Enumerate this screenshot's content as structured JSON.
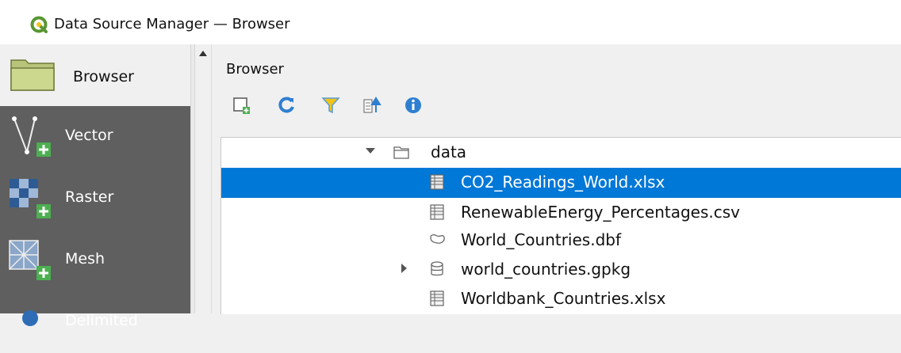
{
  "window": {
    "title": "Data Source Manager — Browser",
    "accent": "#0078d7"
  },
  "sidebar": {
    "items": [
      {
        "label": "Browser",
        "icon": "folder-icon",
        "active": true
      },
      {
        "label": "Vector",
        "icon": "vector-add-icon"
      },
      {
        "label": "Raster",
        "icon": "raster-add-icon"
      },
      {
        "label": "Mesh",
        "icon": "mesh-add-icon"
      },
      {
        "label": "Delimited",
        "icon": "delimited-text-icon"
      }
    ]
  },
  "panel": {
    "title": "Browser",
    "toolbar": [
      {
        "name": "add-layer-button",
        "icon": "add-layer-icon"
      },
      {
        "name": "refresh-button",
        "icon": "refresh-icon"
      },
      {
        "name": "filter-button",
        "icon": "filter-icon"
      },
      {
        "name": "collapse-all-button",
        "icon": "collapse-all-icon"
      },
      {
        "name": "properties-button",
        "icon": "info-icon"
      }
    ]
  },
  "tree": {
    "items": [
      {
        "label": "data",
        "icon": "folder-icon",
        "expanded": true
      },
      {
        "label": "CO2_Readings_World.xlsx",
        "icon": "table-icon",
        "selected": true
      },
      {
        "label": "RenewableEnergy_Percentages.csv",
        "icon": "table-icon"
      },
      {
        "label": "World_Countries.dbf",
        "icon": "polygon-icon"
      },
      {
        "label": "world_countries.gpkg",
        "icon": "database-icon",
        "collapsed": true
      },
      {
        "label": "Worldbank_Countries.xlsx",
        "icon": "table-icon"
      }
    ]
  }
}
